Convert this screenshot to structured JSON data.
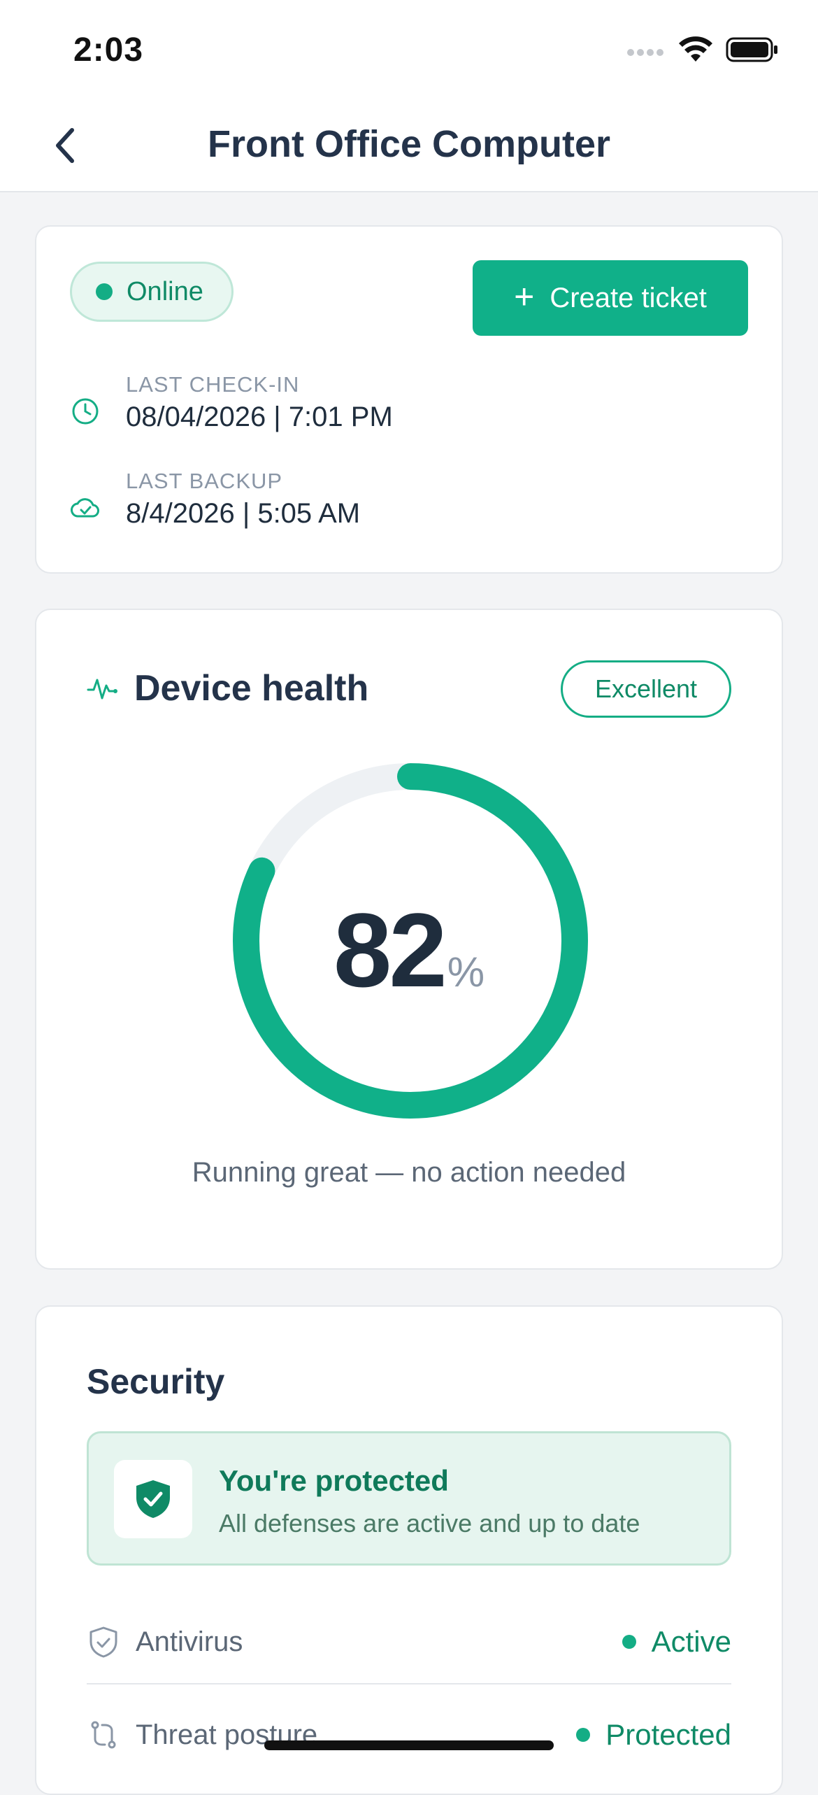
{
  "status_bar": {
    "time": "2:03"
  },
  "nav": {
    "title": "Front Office Computer"
  },
  "summary": {
    "status_label": "Online",
    "create_ticket_label": "Create ticket",
    "last_checkin_label": "LAST CHECK-IN",
    "last_checkin_value": "08/04/2026 | 7:01 PM",
    "last_backup_label": "LAST BACKUP",
    "last_backup_value": "8/4/2026 | 5:05 AM"
  },
  "health": {
    "title": "Device health",
    "rating": "Excellent",
    "score": "82",
    "score_unit": "%",
    "score_fraction": 0.82,
    "caption": "Running great — no action needed"
  },
  "security": {
    "title": "Security",
    "banner_title": "You're protected",
    "banner_subtitle": "All defenses are active and up to date",
    "items": [
      {
        "label": "Antivirus",
        "status": "Active"
      },
      {
        "label": "Threat posture",
        "status": "Protected"
      }
    ]
  },
  "colors": {
    "accent": "#10b089",
    "accent_dark": "#0f8a66",
    "track": "#eef1f4"
  }
}
